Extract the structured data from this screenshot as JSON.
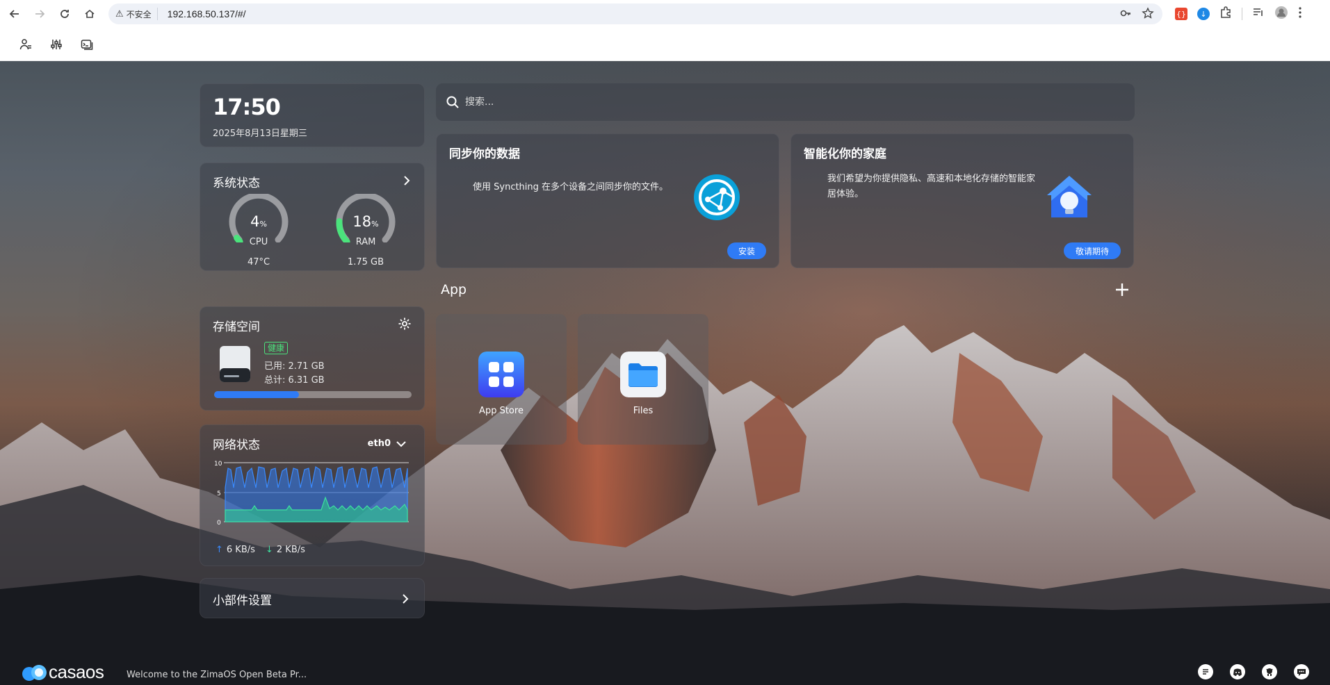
{
  "browser": {
    "security_label": "不安全",
    "url": "192.168.50.137/#/"
  },
  "clock": {
    "time": "17:50",
    "date": "2025年8月13日星期三"
  },
  "system_status": {
    "title": "系统状态",
    "cpu": {
      "value": "4",
      "unit": "%",
      "label": "CPU",
      "sub": "47°C",
      "fraction": 0.04
    },
    "ram": {
      "value": "18",
      "unit": "%",
      "label": "RAM",
      "sub": "1.75 GB",
      "fraction": 0.18
    }
  },
  "storage": {
    "title": "存储空间",
    "health": "健康",
    "used": "已用: 2.71 GB",
    "total": "总计: 6.31 GB",
    "usage_fraction": 0.43
  },
  "network": {
    "title": "网络状态",
    "interface": "eth0",
    "ticks": [
      "10",
      "5",
      "0"
    ],
    "upload": "6 KB/s",
    "download": "2 KB/s"
  },
  "widget_settings": {
    "title": "小部件设置"
  },
  "search": {
    "placeholder": "搜索..."
  },
  "features": [
    {
      "title": "同步你的数据",
      "desc": "使用 Syncthing 在多个设备之间同步你的文件。",
      "button": "安装"
    },
    {
      "title": "智能化你的家庭",
      "desc": "我们希望为你提供隐私、高速和本地化存储的智能家居体验。",
      "button": "敬请期待"
    }
  ],
  "apps_section": {
    "title": "App"
  },
  "apps": [
    {
      "name": "App Store"
    },
    {
      "name": "Files"
    }
  ],
  "footer": {
    "logo": "casaos",
    "welcome": "Welcome to the ZimaOS Open Beta Pr..."
  },
  "colors": {
    "accent": "#2f7bf5",
    "gauge": "#4be37c",
    "health": "#4be37c"
  }
}
